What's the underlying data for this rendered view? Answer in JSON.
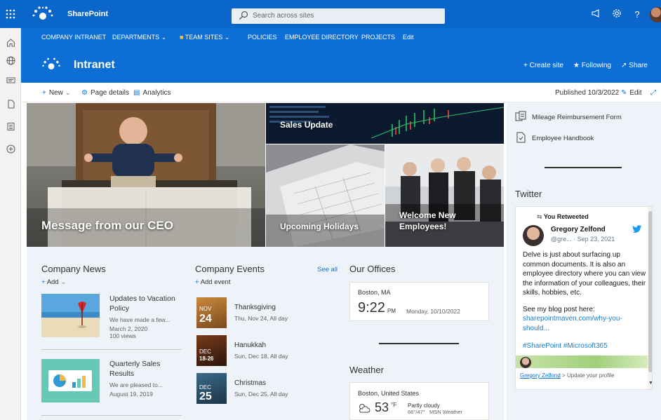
{
  "suite": {
    "app_name": "SharePoint",
    "search_placeholder": "Search across sites",
    "icons": [
      "waffle-icon",
      "megaphone-icon",
      "gear-icon",
      "help-icon"
    ],
    "help_label": "?",
    "accent": "#0a66c8"
  },
  "hubnav": {
    "items": [
      {
        "label": "COMPANY INTRANET"
      },
      {
        "label": "DEPARTMENTS"
      },
      {
        "label": "TEAM SITES"
      },
      {
        "label": "POLICIES"
      },
      {
        "label": "EMPLOYEE DIRECTORY"
      },
      {
        "label": "PROJECTS"
      },
      {
        "label": "Edit"
      }
    ]
  },
  "site": {
    "title": "Intranet",
    "actions": {
      "create": "Create site",
      "following": "Following",
      "share": "Share"
    }
  },
  "commandbar": {
    "new": "New",
    "page_details": "Page details",
    "analytics": "Analytics",
    "published": "Published 10/3/2022",
    "edit": "Edit"
  },
  "hero": {
    "main": "Message from our CEO",
    "sales": "Sales Update",
    "holidays": "Upcoming Holidays",
    "welcome": "Welcome New Employees!"
  },
  "news": {
    "title": "Company News",
    "add": "Add",
    "items": [
      {
        "title": "Updates to Vacation Policy",
        "excerpt": "We have made a few...",
        "date": "March 2, 2020",
        "views": "100 views"
      },
      {
        "title": "Quarterly Sales Results",
        "excerpt": "We are pleased to...",
        "date": "August 19, 2019"
      }
    ]
  },
  "events": {
    "title": "Company Events",
    "see_all": "See all",
    "add": "Add event",
    "items": [
      {
        "month": "NOV",
        "day": "24",
        "name": "Thanksgiving",
        "when": "Thu, Nov 24, All day"
      },
      {
        "month": "DEC",
        "day": "18-26",
        "name": "Hanukkah",
        "when": "Sun, Dec 18, All day"
      },
      {
        "month": "DEC",
        "day": "25",
        "name": "Christmas",
        "when": "Sun, Dec 25, All day"
      }
    ]
  },
  "offices": {
    "title": "Our Offices",
    "city": "Boston, MA",
    "time": "9:22",
    "ampm": "PM",
    "date": "Monday, 10/10/2022"
  },
  "weather": {
    "title": "Weather",
    "location": "Boston, United States",
    "temp": "53",
    "unit": "°F",
    "condition": "Partly cloudy",
    "range": "66°/47°",
    "source": "MSN Weather"
  },
  "quicklinks": {
    "items": [
      {
        "label": "Mileage Reimbursement Form"
      },
      {
        "label": "Employee Handbook"
      }
    ]
  },
  "twitter": {
    "title": "Twitter",
    "retweeted": "You Retweeted",
    "author": "Gregory Zelfond",
    "handle": "@gre...",
    "date": "· Sep 23, 2021",
    "text1": "Delve is just about surfacing up common documents. It is also an employee directory where you can view the information of your colleagues, their skills, hobbies, etc.",
    "text2": "See my blog post here:",
    "link": "sharepointmaven.com/why-you-should...",
    "hashtags": "#SharePoint #Microsoft365",
    "profile_name": "Gregory Zelfond",
    "profile_sep": ">",
    "profile_action": "Update your profile"
  }
}
